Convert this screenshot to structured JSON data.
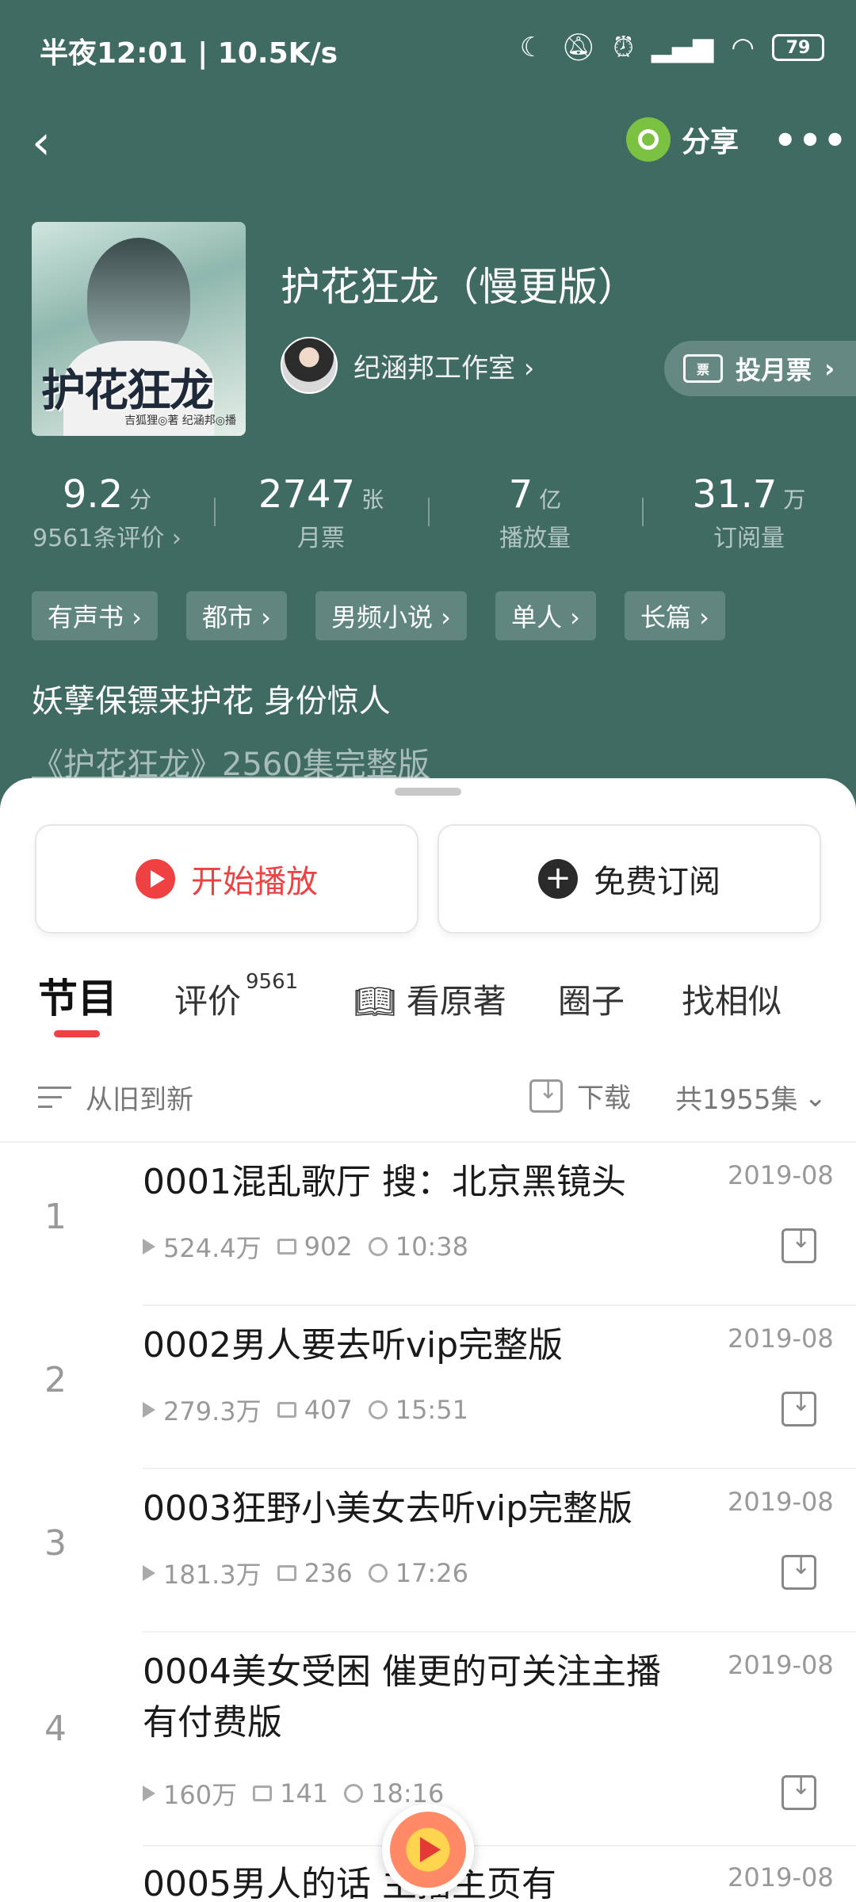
{
  "status": {
    "text": "半夜12:01 | 10.5K/s",
    "battery": "79"
  },
  "nav": {
    "share_label": "分享",
    "more": "•••",
    "back": "‹"
  },
  "book": {
    "cover_title": "护花狂龙",
    "cover_sub": "吉狐狸◎著 纪涵邦◎播",
    "title": "护花狂龙（慢更版）",
    "author": "纪涵邦工作室 ›",
    "vote_label": "投月票",
    "vote_icon": "票"
  },
  "stats": [
    {
      "num": "9.2",
      "unit": "分",
      "label": "9561条评价 ›"
    },
    {
      "num": "2747",
      "unit": "张",
      "label": "月票"
    },
    {
      "num": "7",
      "unit": "亿",
      "label": "播放量"
    },
    {
      "num": "31.7",
      "unit": "万",
      "label": "订阅量"
    }
  ],
  "tags": [
    "有声书 ›",
    "都市 ›",
    "男频小说 ›",
    "单人 ›",
    "长篇 ›"
  ],
  "desc": {
    "line1": "妖孽保镖来护花 身份惊人",
    "line2": "《护花狂龙》2560集完整版"
  },
  "actions": {
    "play": "开始播放",
    "subscribe": "免费订阅"
  },
  "tabs": {
    "program": "节目",
    "review": "评价",
    "review_count": "9561",
    "original": "看原著",
    "circle": "圈子",
    "similar": "找相似"
  },
  "filter": {
    "sort": "从旧到新",
    "download": "下载",
    "total": "共1955集"
  },
  "episodes": [
    {
      "index": "1",
      "title": "0001混乱歌厅 搜：北京黑镜头",
      "date": "2019-08",
      "plays": "524.4万",
      "comments": "902",
      "duration": "10:38"
    },
    {
      "index": "2",
      "title": "0002男人要去听vip完整版",
      "date": "2019-08",
      "plays": "279.3万",
      "comments": "407",
      "duration": "15:51"
    },
    {
      "index": "3",
      "title": "0003狂野小美女去听vip完整版",
      "date": "2019-08",
      "plays": "181.3万",
      "comments": "236",
      "duration": "17:26"
    },
    {
      "index": "4",
      "title": "0004美女受困 催更的可关注主播有付费版",
      "date": "2019-08",
      "plays": "160万",
      "comments": "141",
      "duration": "18:16"
    },
    {
      "index": "5",
      "title": "0005男人的话 主播主页有",
      "date": "2019-08"
    }
  ]
}
